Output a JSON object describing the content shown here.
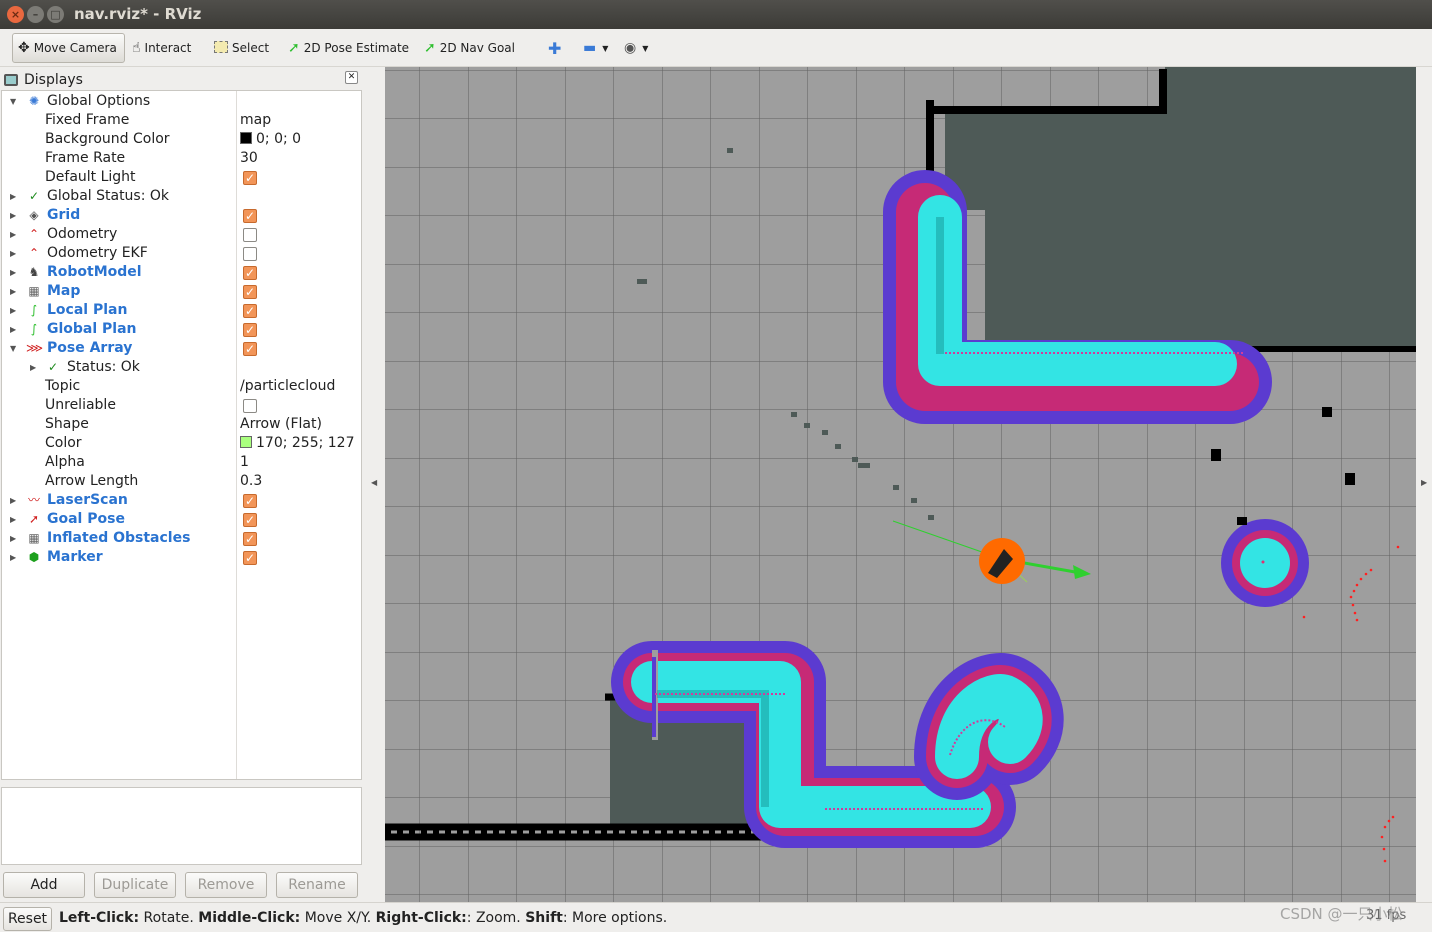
{
  "window": {
    "title": "nav.rviz* - RViz",
    "close_glyph": "×",
    "min_glyph": "–",
    "max_glyph": "□"
  },
  "toolbar": {
    "tools": [
      {
        "label": "Move Camera",
        "icon": "move-camera-icon",
        "active": true
      },
      {
        "label": "Interact",
        "icon": "hand-icon"
      },
      {
        "label": "Select",
        "icon": "select-box-icon"
      },
      {
        "label": "2D Pose Estimate",
        "icon": "green-arrow-icon"
      },
      {
        "label": "2D Nav Goal",
        "icon": "green-arrow-icon"
      }
    ],
    "extra_icons": [
      "plus-icon",
      "minus-icon",
      "eye-icon"
    ]
  },
  "displays": {
    "header": "Displays",
    "rows": [
      {
        "name": "Global Options",
        "expanded": true,
        "icon": "gear-icon"
      },
      {
        "name": "Fixed Frame",
        "value": "map"
      },
      {
        "name": "Background Color",
        "value": "0; 0; 0",
        "swatch": "#000000"
      },
      {
        "name": "Frame Rate",
        "value": "30"
      },
      {
        "name": "Default Light",
        "checked": true
      },
      {
        "name": "Global Status: Ok",
        "icon": "check-icon"
      },
      {
        "name": "Grid",
        "checked": true,
        "icon": "grid-icon"
      },
      {
        "name": "Odometry",
        "checked": false,
        "icon": "odometry-icon"
      },
      {
        "name": "Odometry EKF",
        "checked": false,
        "icon": "odometry-icon"
      },
      {
        "name": "RobotModel",
        "checked": true,
        "icon": "robot-model-icon"
      },
      {
        "name": "Map",
        "checked": true,
        "icon": "map-icon"
      },
      {
        "name": "Local Plan",
        "checked": true,
        "icon": "path-icon"
      },
      {
        "name": "Global Plan",
        "checked": true,
        "icon": "path-icon"
      },
      {
        "name": "Pose Array",
        "checked": true,
        "expanded": true,
        "icon": "pose-array-icon"
      },
      {
        "name": "Status: Ok",
        "icon": "check-icon"
      },
      {
        "name": "Topic",
        "value": "/particlecloud"
      },
      {
        "name": "Unreliable",
        "checked": false
      },
      {
        "name": "Shape",
        "value": "Arrow (Flat)"
      },
      {
        "name": "Color",
        "value": "170; 255; 127",
        "swatch": "#aaff7f"
      },
      {
        "name": "Alpha",
        "value": "1"
      },
      {
        "name": "Arrow Length",
        "value": "0.3"
      },
      {
        "name": "LaserScan",
        "checked": true,
        "icon": "laser-scan-icon"
      },
      {
        "name": "Goal Pose",
        "checked": true,
        "icon": "goal-pose-icon"
      },
      {
        "name": "Inflated Obstacles",
        "checked": true,
        "icon": "map-icon"
      },
      {
        "name": "Marker",
        "checked": true,
        "icon": "marker-cube-icon"
      }
    ],
    "buttons": {
      "add": "Add",
      "duplicate": "Duplicate",
      "remove": "Remove",
      "rename": "Rename"
    }
  },
  "statusbar": {
    "reset": "Reset",
    "hint_parts": [
      {
        "text": "Left-Click:",
        "bold": true
      },
      {
        "text": " Rotate. ",
        "bold": false
      },
      {
        "text": "Middle-Click:",
        "bold": true
      },
      {
        "text": " Move X/Y. ",
        "bold": false
      },
      {
        "text": "Right-Click:",
        "bold": true
      },
      {
        "text": ": Zoom. ",
        "bold": false
      },
      {
        "text": "Shift",
        "bold": true
      },
      {
        "text": ": More options.",
        "bold": false
      }
    ],
    "fps": "31 fps"
  },
  "watermark": "CSDN @一只小松",
  "colors": {
    "grid_bg": "#9e9e9e",
    "grid_line": "#2d2d2d",
    "unknown_area": "#4e5a57",
    "obstacle": "#000000",
    "inflation_outer": "#5b3bd0",
    "inflation_inner": "#c62a76",
    "inscribed": "#33e4e4",
    "robot": "#ff6a00",
    "goal_arrow": "#2fd02f",
    "laser": "#ff2020",
    "check_orange": "#f29558",
    "link_blue": "#2a73d0"
  }
}
